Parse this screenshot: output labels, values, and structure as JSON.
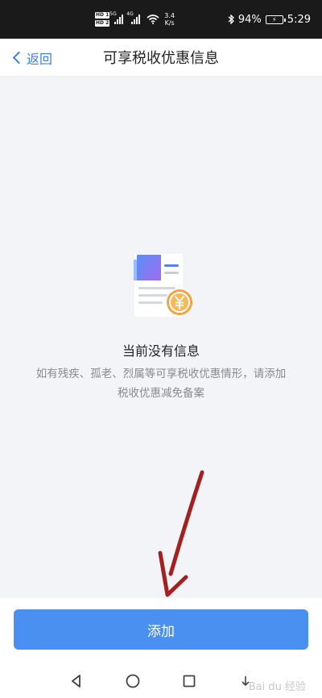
{
  "status_bar": {
    "speed_value": "3.4",
    "speed_unit": "K/s",
    "battery_percent": "94%",
    "time": "5:29"
  },
  "nav": {
    "back_label": "返回",
    "title": "可享税收优惠信息"
  },
  "empty_state": {
    "title": "当前没有信息",
    "description": "如有残疾、孤老、烈属等可享税收优惠情形，请添加税收优惠减免备案",
    "icon": "document-yuan-icon"
  },
  "actions": {
    "add_label": "添加"
  },
  "colors": {
    "accent": "#4a90f0",
    "link": "#3d7fe5",
    "coin": "#f0a540",
    "annotation_arrow": "#a42020"
  }
}
